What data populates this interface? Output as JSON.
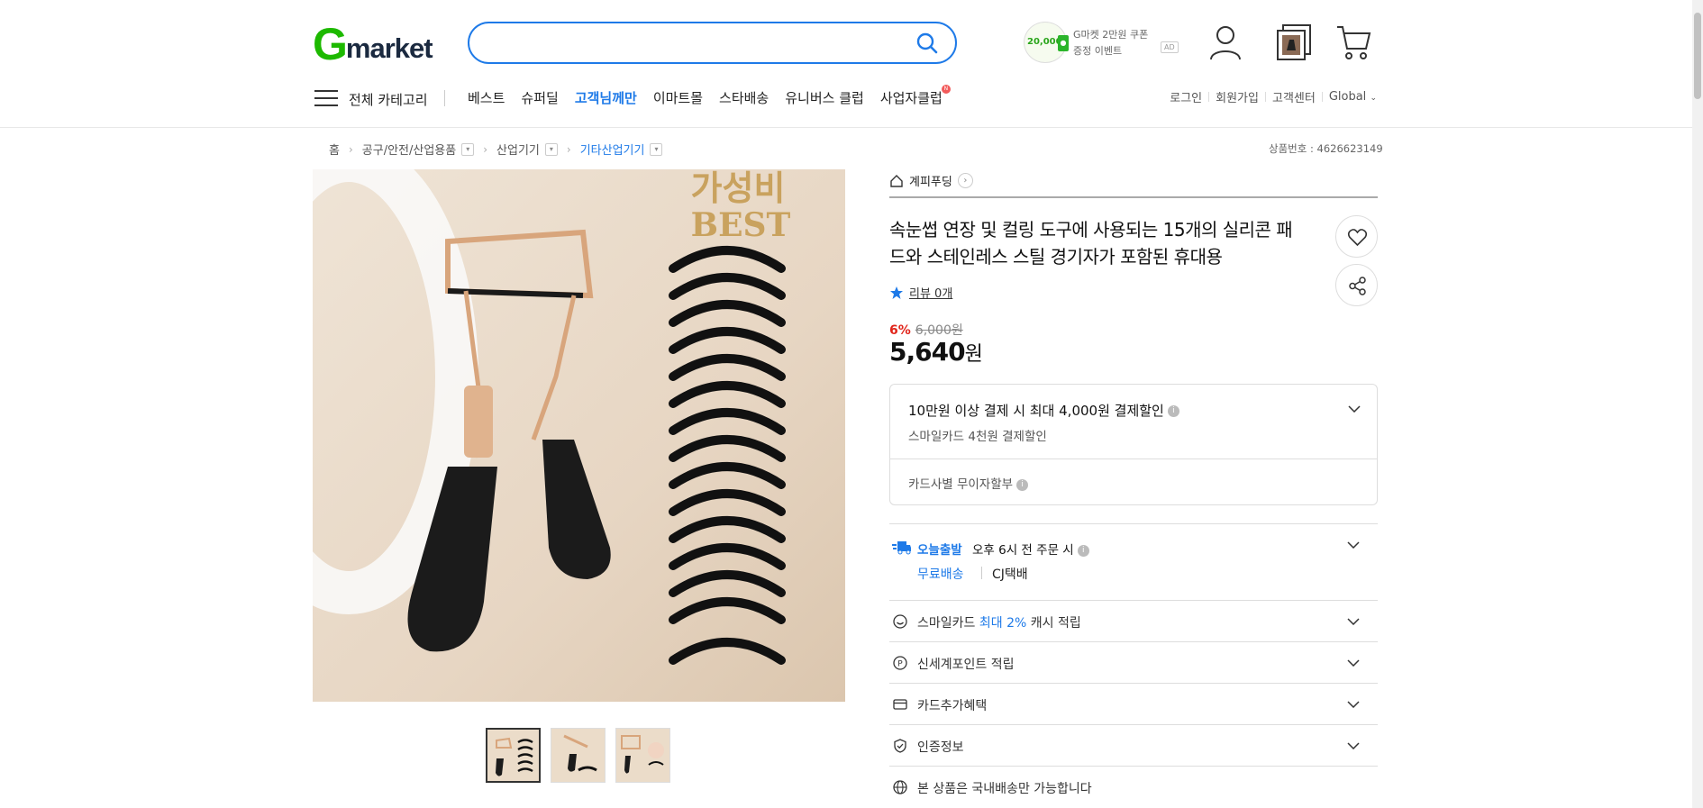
{
  "header": {
    "logo_g": "G",
    "logo_rest": "market",
    "search": {
      "placeholder": "",
      "value": ""
    },
    "promo": {
      "badge_num": "20,000",
      "line1": "G마켓 2만원 쿠폰",
      "line2": "증정 이벤트",
      "ad": "AD"
    }
  },
  "nav": {
    "all_category": "전체 카테고리",
    "menu": [
      "베스트",
      "슈퍼딜",
      "고객님께만",
      "이마트몰",
      "스타배송",
      "유니버스 클럽",
      "사업자클럽"
    ],
    "active_index": 2,
    "new_badge": "N",
    "util": [
      "로그인",
      "회원가입",
      "고객센터",
      "Global"
    ]
  },
  "breadcrumb": [
    "홈",
    "공구/안전/산업용품",
    "산업기기",
    "기타산업기기"
  ],
  "product_no": "상품번호 : 4626623149",
  "image": {
    "overlay_line1": "가성비",
    "overlay_line2": "BEST"
  },
  "product": {
    "store": "계피푸딩",
    "title": "속눈썹 연장 및 컬링 도구에 사용되는 15개의 실리콘 패드와 스테인레스 스틸 경기자가 포함된 휴대용",
    "review": "리뷰 0개",
    "discount_pct": "6%",
    "orig_price": "6,000원",
    "price": "5,640",
    "price_unit": "원"
  },
  "card_box": {
    "line1": "10만원 이상 결제 시 최대 4,000원 결제할인",
    "line2": "스마일카드 4천원 결제할인",
    "line3": "카드사별 무이자할부"
  },
  "shipping": {
    "label": "오늘출발",
    "text": "오후 6시 전 주문 시",
    "free": "무료배송",
    "courier": "CJ택배"
  },
  "benefits": {
    "smile_pre": "스마일카드 ",
    "smile_blue": "최대 2%",
    "smile_post": " 캐시 적립",
    "shinsegae": "신세계포인트 적립",
    "card_extra": "카드추가혜택",
    "cert": "인증정보",
    "domestic": "본 상품은 국내배송만 가능합니다"
  },
  "colors": {
    "brand_green": "#1db900",
    "accent_blue": "#1e7ae8",
    "discount_red": "#e1251b"
  }
}
